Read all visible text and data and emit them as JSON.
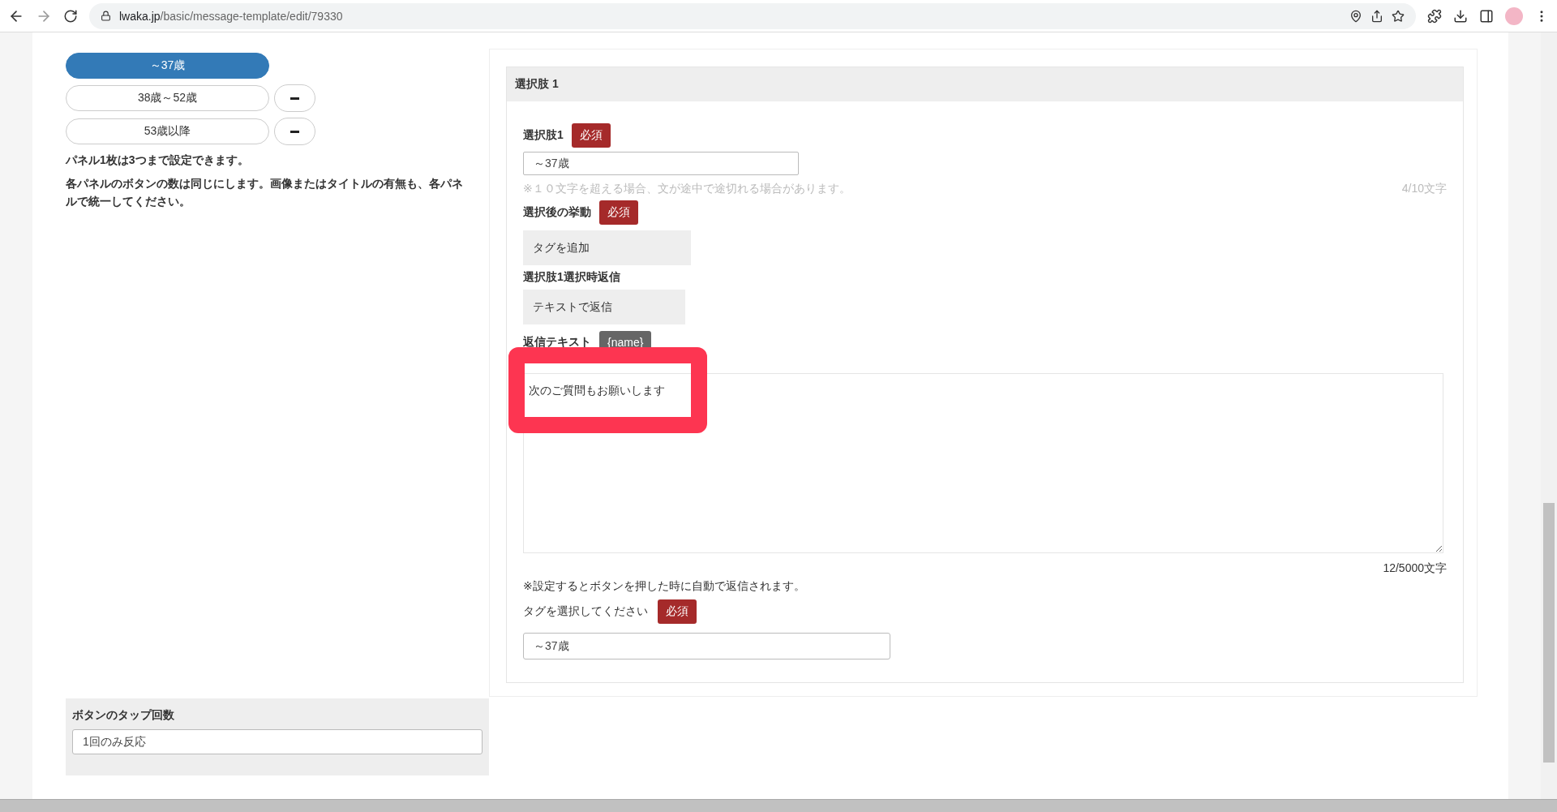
{
  "browser": {
    "url_host": "lwaka.jp",
    "url_path": "/basic/message-template/edit/79330"
  },
  "choice_buttons": [
    {
      "label": "～37歳",
      "selected": true,
      "removable": false
    },
    {
      "label": "38歳～52歳",
      "selected": false,
      "removable": true
    },
    {
      "label": "53歳以降",
      "selected": false,
      "removable": true
    }
  ],
  "notes": [
    "パネル1枚は3つまで設定できます。",
    "各パネルのボタンの数は同じにします。画像またはタイトルの有無も、各パネルで統一してください。"
  ],
  "choice_panel": {
    "title": "選択肢 1",
    "choice_label": {
      "label": "選択肢1",
      "badge": "必須",
      "value": "～37歳",
      "hint": "※１０文字を超える場合、文が途中で途切れる場合があります。",
      "counter": "4/10文字"
    },
    "action": {
      "label": "選択後の挙動",
      "badge": "必須",
      "value": "タグを追加"
    },
    "reply_mode": {
      "label": "選択肢1選択時返信",
      "value": "テキストで返信"
    },
    "reply_text": {
      "label": "返信テキスト",
      "tag": "{name}",
      "value": "次のご質問もお願いします",
      "counter": "12/5000文字",
      "note": "※設定するとボタンを押した時に自動で返信されます。",
      "highlighted": true
    },
    "tag_select": {
      "label": "タグを選択してください",
      "badge": "必須",
      "value": "～37歳"
    }
  },
  "tap_count": {
    "label": "ボタンのタップ回数",
    "value": "1回のみ反応"
  }
}
